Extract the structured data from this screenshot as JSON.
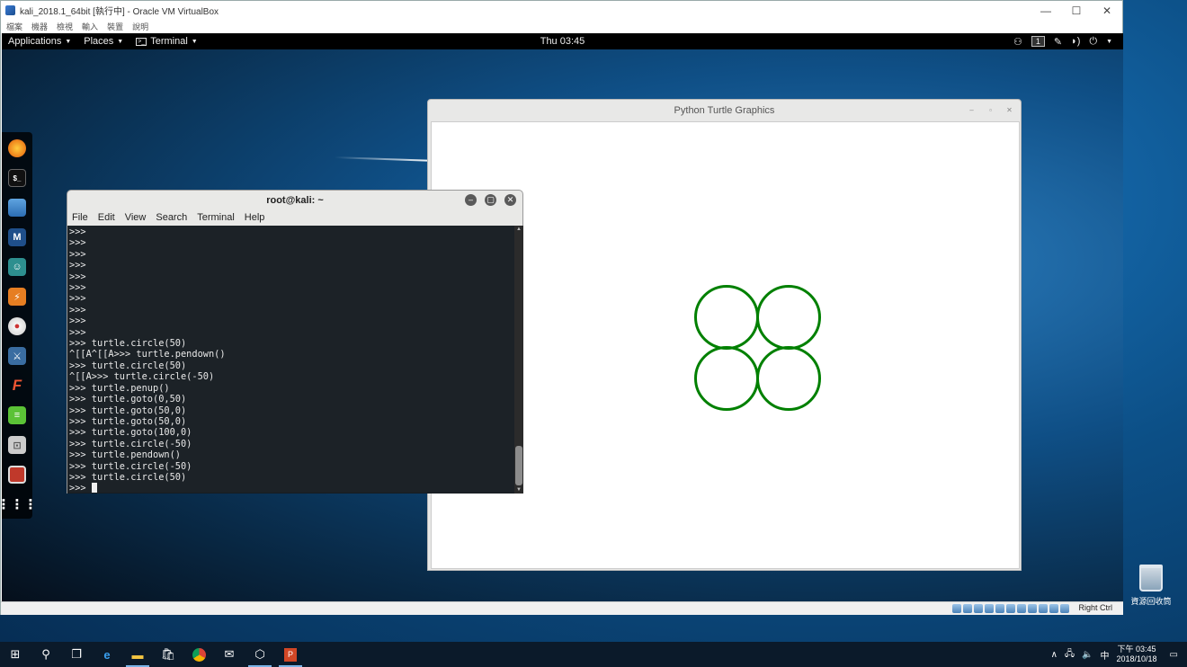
{
  "host": {
    "vbox_title": "kali_2018.1_64bit [執行中] - Oracle VM VirtualBox",
    "vbox_menu": [
      "檔案",
      "機器",
      "檢視",
      "輸入",
      "裝置",
      "說明"
    ],
    "window_controls": {
      "minimize": "—",
      "maximize": "☐",
      "close": "✕"
    },
    "recycle_bin_label": "資源回收筒",
    "host_key_label": "Right Ctrl",
    "taskbar": {
      "time": "下午 03:45",
      "date": "2018/10/18",
      "ime": "中",
      "items": [
        "start-icon",
        "search-icon",
        "task-view-icon",
        "edge-icon",
        "file-explorer-icon",
        "store-icon",
        "chrome-icon",
        "mail-icon",
        "virtualbox-icon",
        "powerpoint-icon"
      ]
    }
  },
  "kali": {
    "topbar": {
      "applications": "Applications",
      "places": "Places",
      "terminal": "Terminal",
      "clock": "Thu 03:45",
      "workspace": "1"
    },
    "dock_icons": [
      "firefox-icon",
      "terminal-icon",
      "files-icon",
      "metasploit-icon",
      "armitage-icon",
      "burpsuite-icon",
      "maltego-icon",
      "beef-icon",
      "faraday-icon",
      "leafpad-icon",
      "cherrytree-icon",
      "app-icon",
      "show-apps-icon"
    ]
  },
  "turtle_window": {
    "title": "Python Turtle Graphics",
    "circle_color": "#008000"
  },
  "terminal": {
    "title": "root@kali: ~",
    "menu": [
      "File",
      "Edit",
      "View",
      "Search",
      "Terminal",
      "Help"
    ],
    "lines": [
      ">>>",
      ">>>",
      ">>>",
      ">>>",
      ">>>",
      ">>>",
      ">>>",
      ">>>",
      ">>>",
      ">>>",
      ">>> turtle.circle(50)",
      "^[[A^[[A>>> turtle.pendown()",
      ">>> turtle.circle(50)",
      "^[[A>>> turtle.circle(-50)",
      ">>> turtle.penup()",
      ">>> turtle.goto(0,50)",
      ">>> turtle.goto(50,0)",
      ">>> turtle.goto(50,0)",
      ">>> turtle.goto(100,0)",
      ">>> turtle.circle(-50)",
      ">>> turtle.pendown()",
      ">>> turtle.circle(-50)",
      ">>> turtle.circle(50)"
    ],
    "prompt": ">>> "
  }
}
